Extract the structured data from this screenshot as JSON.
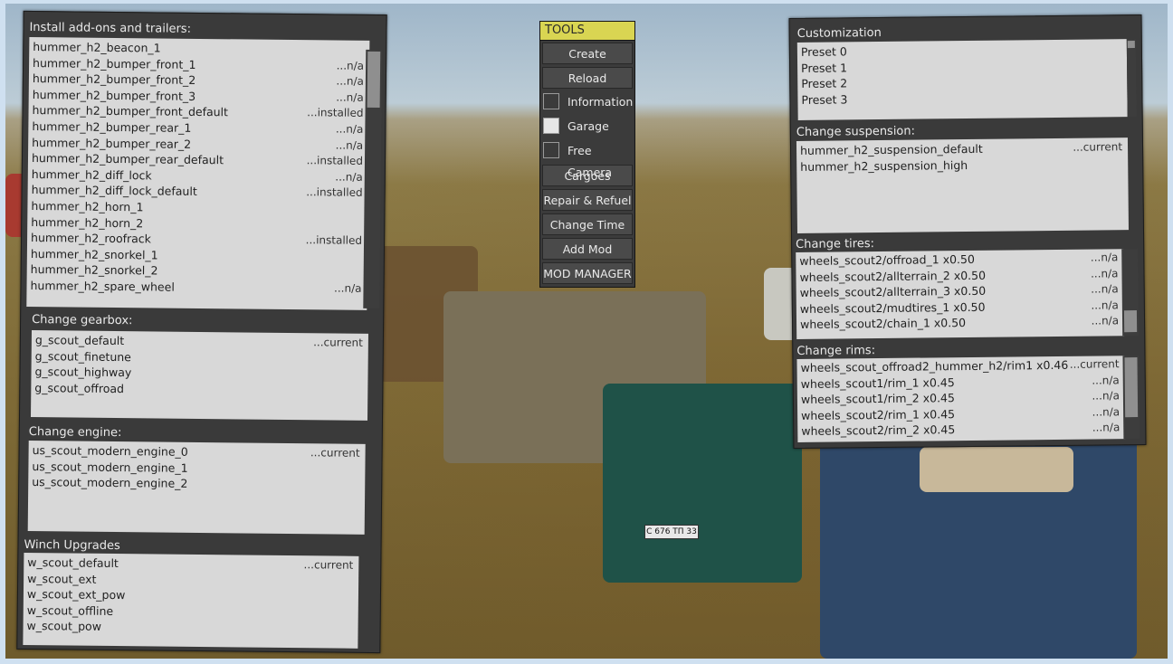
{
  "left_panel": {
    "addons": {
      "title": "Install add-ons and trailers:",
      "items": [
        {
          "name": "hummer_h2_beacon_1",
          "status": ""
        },
        {
          "name": "hummer_h2_bumper_front_1",
          "status": "...n/a"
        },
        {
          "name": "hummer_h2_bumper_front_2",
          "status": "...n/a"
        },
        {
          "name": "hummer_h2_bumper_front_3",
          "status": "...n/a"
        },
        {
          "name": "hummer_h2_bumper_front_default",
          "status": "...installed"
        },
        {
          "name": "hummer_h2_bumper_rear_1",
          "status": "...n/a"
        },
        {
          "name": "hummer_h2_bumper_rear_2",
          "status": "...n/a"
        },
        {
          "name": "hummer_h2_bumper_rear_default",
          "status": "...installed"
        },
        {
          "name": "hummer_h2_diff_lock",
          "status": "...n/a"
        },
        {
          "name": "hummer_h2_diff_lock_default",
          "status": "...installed"
        },
        {
          "name": "hummer_h2_horn_1",
          "status": ""
        },
        {
          "name": "hummer_h2_horn_2",
          "status": ""
        },
        {
          "name": "hummer_h2_roofrack",
          "status": "...installed"
        },
        {
          "name": "hummer_h2_snorkel_1",
          "status": ""
        },
        {
          "name": "hummer_h2_snorkel_2",
          "status": ""
        },
        {
          "name": "hummer_h2_spare_wheel",
          "status": "...n/a"
        }
      ]
    },
    "gearbox": {
      "title": "Change gearbox:",
      "items": [
        {
          "name": "g_scout_default",
          "status": "...current"
        },
        {
          "name": "g_scout_finetune",
          "status": ""
        },
        {
          "name": "g_scout_highway",
          "status": ""
        },
        {
          "name": "g_scout_offroad",
          "status": ""
        }
      ]
    },
    "engine": {
      "title": "Change engine:",
      "items": [
        {
          "name": "us_scout_modern_engine_0",
          "status": "...current"
        },
        {
          "name": "us_scout_modern_engine_1",
          "status": ""
        },
        {
          "name": "us_scout_modern_engine_2",
          "status": ""
        }
      ]
    },
    "winch": {
      "title": "Winch Upgrades",
      "items": [
        {
          "name": "w_scout_default",
          "status": "...current"
        },
        {
          "name": "w_scout_ext",
          "status": ""
        },
        {
          "name": "w_scout_ext_pow",
          "status": ""
        },
        {
          "name": "w_scout_offline",
          "status": ""
        },
        {
          "name": "w_scout_pow",
          "status": ""
        }
      ]
    }
  },
  "tools": {
    "title": "TOOLS",
    "create": "Create",
    "reload": "Reload",
    "information": "Information",
    "garage": "Garage",
    "free_camera": "Free Camera",
    "cargoes": "Cargoes",
    "repair": "Repair & Refuel",
    "change_time": "Change Time",
    "add_mod": "Add Mod",
    "mod_manager": "MOD MANAGER",
    "information_checked": false,
    "garage_checked": true,
    "free_camera_checked": false
  },
  "right_panel": {
    "customization": {
      "title": "Customization",
      "items": [
        {
          "name": "Preset 0",
          "status": ""
        },
        {
          "name": "Preset 1",
          "status": ""
        },
        {
          "name": "Preset 2",
          "status": ""
        },
        {
          "name": "Preset 3",
          "status": ""
        }
      ]
    },
    "suspension": {
      "title": "Change suspension:",
      "items": [
        {
          "name": "hummer_h2_suspension_default",
          "status": "...current"
        },
        {
          "name": "hummer_h2_suspension_high",
          "status": ""
        }
      ]
    },
    "tires": {
      "title": "Change tires:",
      "items": [
        {
          "name": "wheels_scout2/offroad_1 x0.50",
          "status": "...n/a"
        },
        {
          "name": "wheels_scout2/allterrain_2 x0.50",
          "status": "...n/a"
        },
        {
          "name": "wheels_scout2/allterrain_3 x0.50",
          "status": "...n/a"
        },
        {
          "name": "wheels_scout2/mudtires_1 x0.50",
          "status": "...n/a"
        },
        {
          "name": "wheels_scout2/chain_1 x0.50",
          "status": "...n/a"
        }
      ]
    },
    "rims": {
      "title": "Change rims:",
      "items": [
        {
          "name": "wheels_scout_offroad2_hummer_h2/rim1 x0.46",
          "status": "...current"
        },
        {
          "name": "wheels_scout1/rim_1 x0.45",
          "status": "...n/a"
        },
        {
          "name": "wheels_scout1/rim_2 x0.45",
          "status": "...n/a"
        },
        {
          "name": "wheels_scout2/rim_1 x0.45",
          "status": "...n/a"
        },
        {
          "name": "wheels_scout2/rim_2 x0.45",
          "status": "...n/a"
        }
      ]
    }
  },
  "scene": {
    "plate_text": "С 676 ТП 33"
  }
}
